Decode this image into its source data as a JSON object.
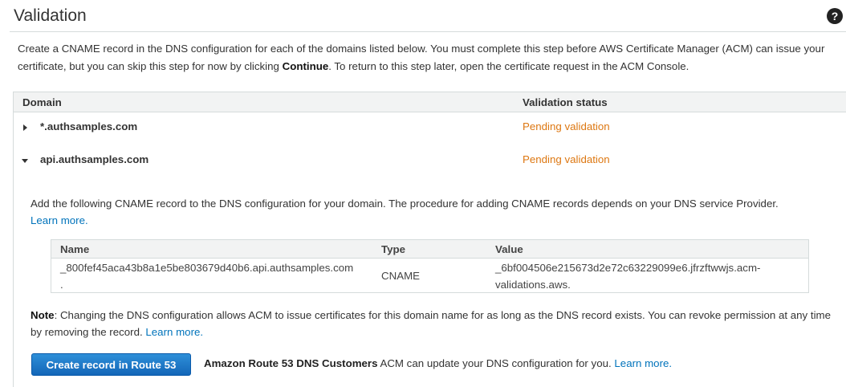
{
  "header": {
    "title": "Validation",
    "help_icon": "question-circle-icon"
  },
  "intro": {
    "text_before": "Create a CNAME record in the DNS configuration for each of the domains listed below. You must complete this step before AWS Certificate Manager (ACM) can issue your certificate, but you can skip this step for now by clicking ",
    "continue_label": "Continue",
    "text_after": ". To return to this step later, open the certificate request in the ACM Console."
  },
  "table": {
    "columns": [
      "Domain",
      "Validation status"
    ],
    "rows": [
      {
        "domain": "*.authsamples.com",
        "status": "Pending validation",
        "expanded": false
      },
      {
        "domain": "api.authsamples.com",
        "status": "Pending validation",
        "expanded": true
      }
    ]
  },
  "detail": {
    "instructions": "Add the following CNAME record to the DNS configuration for your domain. The procedure for adding CNAME records depends on your DNS service Provider.",
    "learn_more": "Learn more.",
    "cname_columns": [
      "Name",
      "Type",
      "Value"
    ],
    "cname_record": {
      "name_line1": "_800fef45aca43b8a1e5be803679d40b6.api.authsamples.com",
      "name_line2": ".",
      "type": "CNAME",
      "value_line1": "_6bf004506e215673d2e72c63229099e6.jfrzftwwjs.acm-",
      "value_line2": "validations.aws."
    },
    "note_label": "Note",
    "note_text": ": Changing the DNS configuration allows ACM to issue certificates for this domain name for as long as the DNS record exists. You can revoke permission at any time by removing the record.",
    "note_learn_more": "Learn more.",
    "route53_button": "Create record in Route 53",
    "route53_bold": "Amazon Route 53 DNS Customers",
    "route53_text": " ACM can update your DNS configuration for you.",
    "route53_learn_more": "Learn more."
  },
  "colors": {
    "pending_status": "#dd7711",
    "link": "#0073bb",
    "primary_button": "#1a73c6"
  }
}
